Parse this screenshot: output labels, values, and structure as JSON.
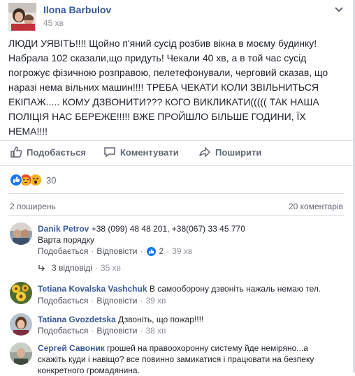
{
  "post": {
    "author": "Ilona Barbulov",
    "time": "45 хв",
    "text_lines": [
      "ЛЮДИ УЯВІТЬ!!!! Щойно п'яний сусід розбив вікна в моєму будинку!",
      "Набрала 102 сказали,що придуть! Чекали 40 хв, а в той час сусід",
      "погрожує фізичною розправою, пелетефонували, черговий сказав, що",
      "наразі нема вільних машин!!!! ТРЕБА ЧЕКАТИ КОЛИ ЗВІЛЬНИТЬСЯ",
      "ЕКІПАЖ..... КОМУ ДЗВОНИТИ??? КОГО ВИКЛИКАТИ((((( ТАК НАША",
      "ПОЛІЦІЯ НАС БЕРЕЖЕ!!!!! ВЖЕ ПРОЙШЛО БІЛЬШЕ ГОДИНИ, ЇХ",
      "НЕМА!!!!"
    ]
  },
  "actions": {
    "like": "Подобається",
    "comment": "Коментувати",
    "share": "Поширити"
  },
  "stats": {
    "reactions_count": "30",
    "shares": "2 поширень",
    "comments": "20 коментарів"
  },
  "comments": [
    {
      "author": "Danik Petrov",
      "text_line1": " +38 (099) 48 48 201, +38(067) 33 45 770",
      "text_line2": "Варта порядку",
      "like": "Подобається",
      "reply": "Відповісти",
      "likes": "2",
      "time": "39 хв",
      "replies": "3 відповіді",
      "replies_time": "35 хв"
    },
    {
      "author": "Tetiana Kovalska Vashchuk",
      "text": " В самооборону дзвоніть нажаль немаю тел.",
      "like": "Подобається",
      "reply": "Відповісти",
      "time": "39 хв"
    },
    {
      "author": "Tatiana Gvozdetska",
      "text": " Дзвоніть, що пожар!!!!",
      "like": "Подобається",
      "reply": "Відповісти",
      "time": "38 хв"
    },
    {
      "author": "Сергей Савоник",
      "text_line1": " грошей на правоохоронну систему йде неміряно...а",
      "text_line2": "скажіть куди і навіщо? все повинно замикатися і працювати на безпеку",
      "text_line3": "конкретного громадянина."
    }
  ],
  "colors": {
    "link": "#385898",
    "like_blue": "#1877f2",
    "muted": "#90949c"
  }
}
